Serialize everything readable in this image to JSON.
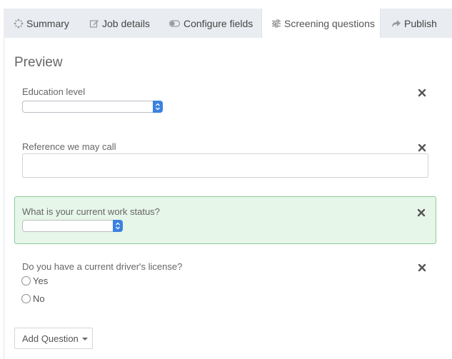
{
  "tabs": [
    {
      "label": "Summary",
      "icon": "spinner-icon"
    },
    {
      "label": "Job details",
      "icon": "edit-icon"
    },
    {
      "label": "Configure fields",
      "icon": "toggle-icon"
    },
    {
      "label": "Screening questions",
      "icon": "sliders-icon",
      "active": true
    },
    {
      "label": "Publish",
      "icon": "share-icon"
    }
  ],
  "preview": {
    "title": "Preview",
    "questions": [
      {
        "label": "Education level",
        "type": "select",
        "value": ""
      },
      {
        "label": "Reference we may call",
        "type": "text",
        "value": ""
      },
      {
        "label": "What is your current work status?",
        "type": "select",
        "value": "",
        "highlighted": true
      },
      {
        "label": "Do you have a current driver's license?",
        "type": "radio",
        "options": [
          "Yes",
          "No"
        ]
      }
    ]
  },
  "actions": {
    "add_question_label": "Add Question"
  },
  "colors": {
    "tabbar_bg": "#e9edf1",
    "highlight_bg": "#e6f6e8",
    "highlight_border": "#8fc99a",
    "select_arrow": "#3b82e0"
  }
}
